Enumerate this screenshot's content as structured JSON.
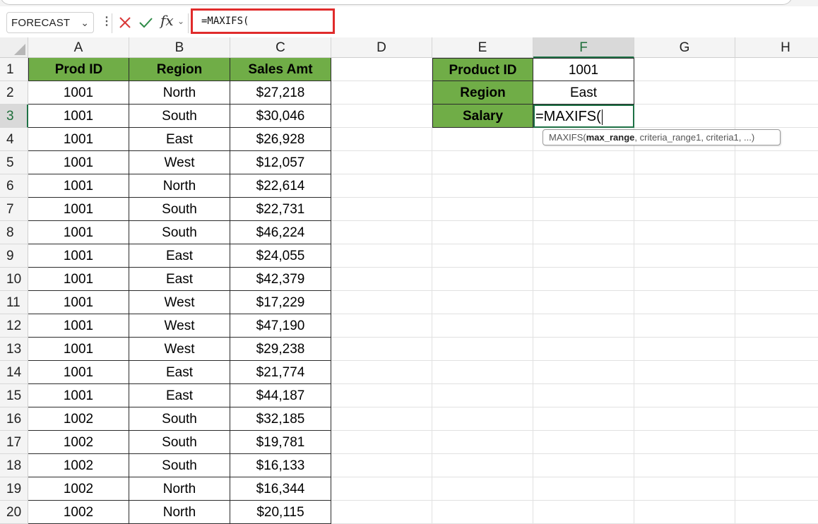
{
  "formula_bar": {
    "name_box": "FORECAST",
    "formula": "=MAXIFS("
  },
  "columns": [
    "A",
    "B",
    "C",
    "D",
    "E",
    "F",
    "G",
    "H"
  ],
  "rows": [
    "1",
    "2",
    "3",
    "4",
    "5",
    "6",
    "7",
    "8",
    "9",
    "10",
    "11",
    "12",
    "13",
    "14",
    "15",
    "16",
    "17",
    "18",
    "19",
    "20"
  ],
  "selected": {
    "column": "F",
    "row": "3"
  },
  "table": {
    "headers": [
      "Prod ID",
      "Region",
      "Sales Amt"
    ],
    "rows": [
      [
        "1001",
        "North",
        "$27,218"
      ],
      [
        "1001",
        "South",
        "$30,046"
      ],
      [
        "1001",
        "East",
        "$26,928"
      ],
      [
        "1001",
        "West",
        "$12,057"
      ],
      [
        "1001",
        "North",
        "$22,614"
      ],
      [
        "1001",
        "South",
        "$22,731"
      ],
      [
        "1001",
        "South",
        "$46,224"
      ],
      [
        "1001",
        "East",
        "$24,055"
      ],
      [
        "1001",
        "East",
        "$42,379"
      ],
      [
        "1001",
        "West",
        "$17,229"
      ],
      [
        "1001",
        "West",
        "$47,190"
      ],
      [
        "1001",
        "West",
        "$29,238"
      ],
      [
        "1001",
        "East",
        "$21,774"
      ],
      [
        "1001",
        "East",
        "$44,187"
      ],
      [
        "1002",
        "South",
        "$32,185"
      ],
      [
        "1002",
        "South",
        "$19,781"
      ],
      [
        "1002",
        "South",
        "$16,133"
      ],
      [
        "1002",
        "North",
        "$16,344"
      ],
      [
        "1002",
        "North",
        "$20,115"
      ]
    ]
  },
  "lookup": {
    "labels": [
      "Product ID",
      "Region",
      "Salary"
    ],
    "values": [
      "1001",
      "East",
      "=MAXIFS("
    ]
  },
  "tooltip": {
    "fn": "MAXIFS(",
    "bold_arg": "max_range",
    "rest": ", criteria_range1, criteria1, ...)"
  },
  "colors": {
    "header_fill": "#70ad47",
    "selection": "#1e7145",
    "highlight_box": "#e02b2b"
  }
}
